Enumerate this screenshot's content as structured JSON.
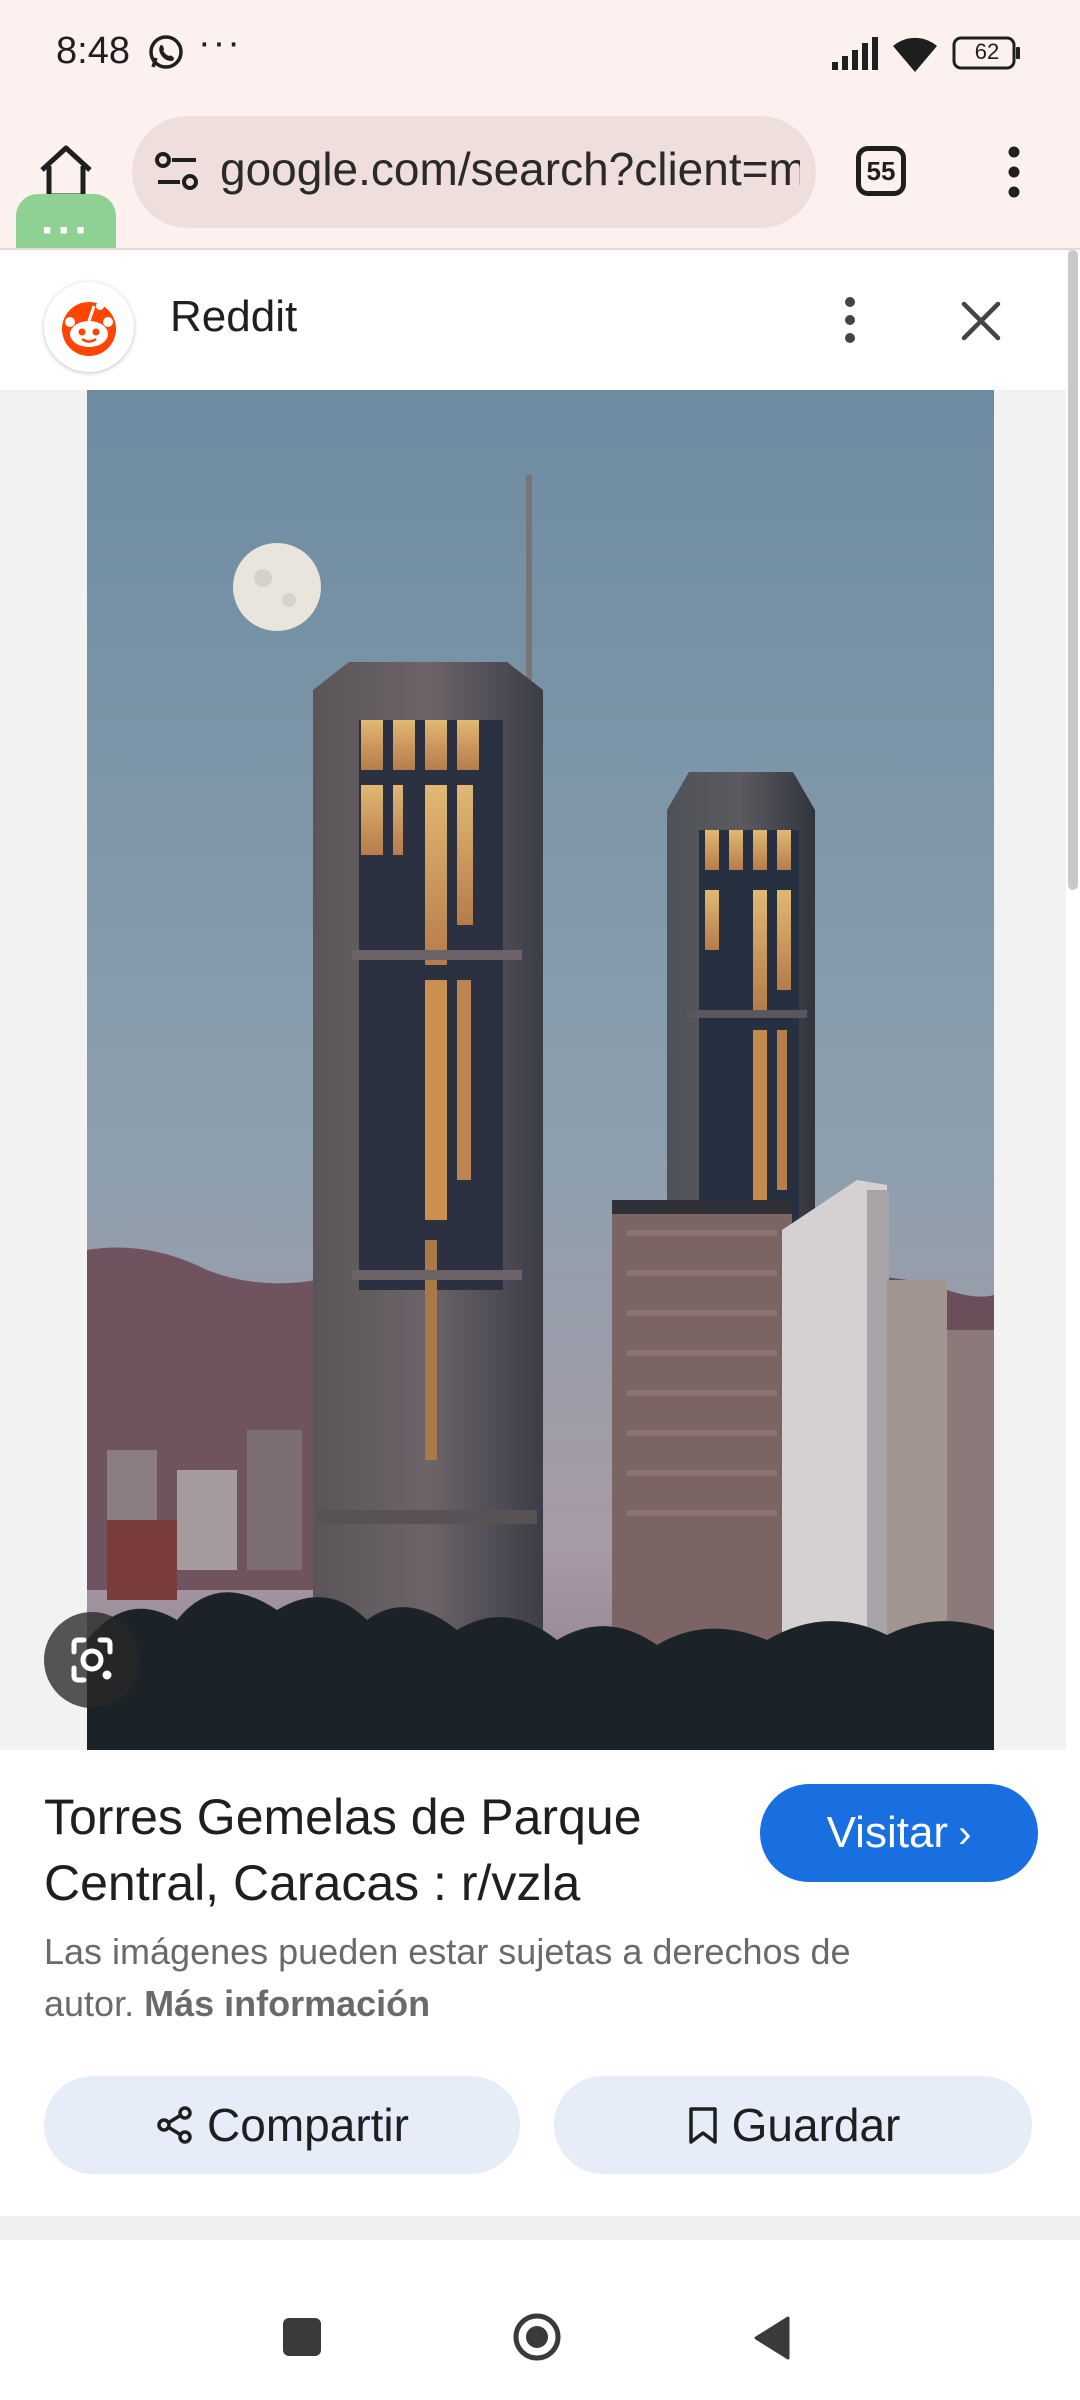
{
  "status_bar": {
    "time": "8:48",
    "more": "···",
    "battery": "62",
    "icons": [
      "whatsapp-icon",
      "signal-icon",
      "wifi-icon",
      "battery-icon"
    ]
  },
  "toolbar": {
    "url": "google.com/search?client=ms-android",
    "tab_count": "55",
    "bubble_label": "···",
    "icons": [
      "home-icon",
      "site-settings-icon",
      "tabs-icon",
      "overflow-menu-icon"
    ]
  },
  "source": {
    "name": "Reddit",
    "icons": [
      "reddit-logo",
      "more-vert-icon",
      "close-icon"
    ]
  },
  "result": {
    "title": "Torres Gemelas de Parque Central, Caracas : r/vzla",
    "visit_label": "Visitar",
    "copyright_text": "Las imágenes pueden estar sujetas a derechos de autor.",
    "more_info_label": "Más información",
    "share_label": "Compartir",
    "save_label": "Guardar"
  },
  "colors": {
    "accent": "#1a6fe0",
    "chrome_bg": "#fdf1ef",
    "button_bg": "#e6ecf8"
  }
}
